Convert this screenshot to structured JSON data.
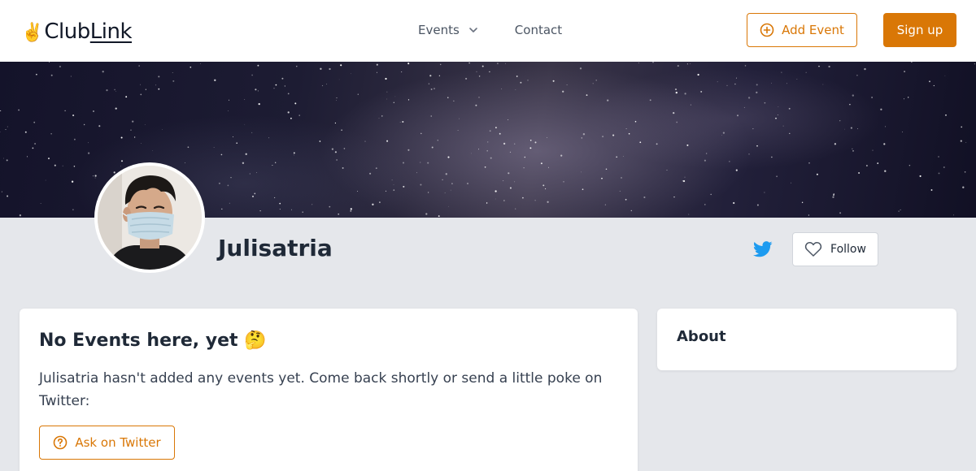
{
  "header": {
    "logo": {
      "hand": "✌️",
      "club": "Club",
      "link": "Link"
    },
    "nav": [
      {
        "label": "Events",
        "has_dropdown": true
      },
      {
        "label": "Contact",
        "has_dropdown": false
      }
    ],
    "add_event_label": "Add Event",
    "signup_label": "Sign up"
  },
  "profile": {
    "name": "Julisatria",
    "follow_label": "Follow"
  },
  "events_card": {
    "title": "No Events here, yet 🤔",
    "body": "Julisatria hasn't added any events yet. Come back shortly or send a little poke on Twitter:",
    "ask_label": "Ask on Twitter"
  },
  "about_card": {
    "title": "About"
  },
  "colors": {
    "accent": "#d97706",
    "background": "#e5e7eb",
    "twitter": "#1d9bf0"
  },
  "icons": {
    "add": "plus-circle-icon",
    "chevron": "chevron-down-icon",
    "twitter": "twitter-icon",
    "follow": "heart-icon",
    "ask": "question-circle-icon"
  }
}
